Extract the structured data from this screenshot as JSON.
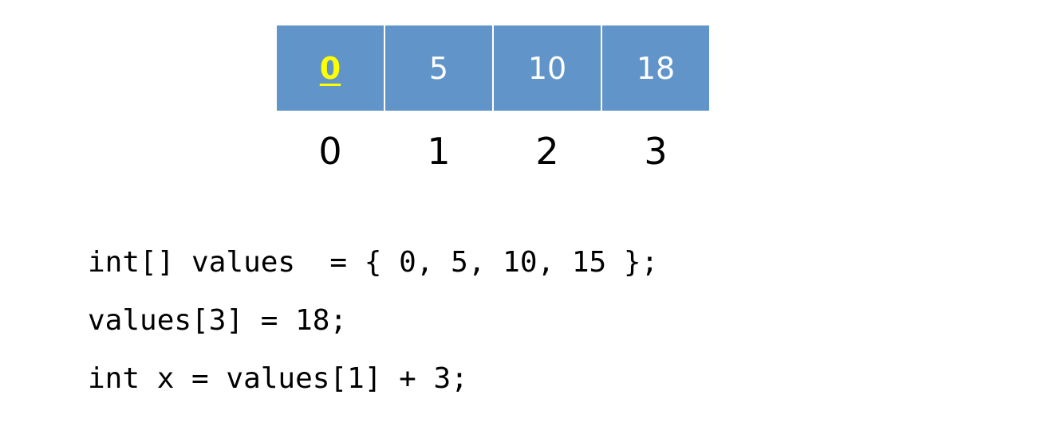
{
  "array": {
    "cells": [
      "0",
      "5",
      "10",
      "18"
    ],
    "highlighted_index": 0,
    "indices": [
      "0",
      "1",
      "2",
      "3"
    ],
    "cell_color": "#6194c8",
    "highlight_color": "#ffff00"
  },
  "code": {
    "lines": [
      "int[] values  = { 0, 5, 10, 15 };",
      "values[3] = 18;",
      "int x = values[1] + 3;"
    ]
  }
}
